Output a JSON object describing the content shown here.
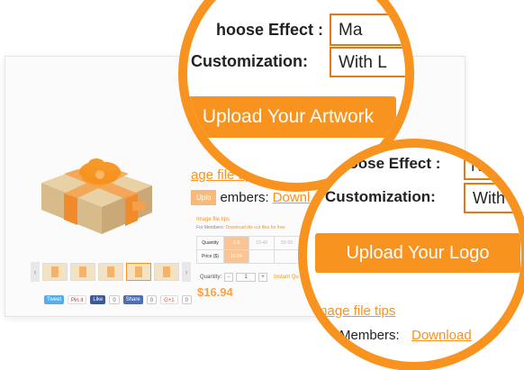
{
  "lens1": {
    "effect_label": "hoose Effect :",
    "effect_value": "Ma",
    "custom_label": "Customization:",
    "custom_value": "With L",
    "upload_button": "Upload Your Artwork",
    "tips_link": "age file tips"
  },
  "lens2": {
    "effect_label": "hoose Effect :",
    "effect_value": "N",
    "custom_label": "Customization:",
    "custom_value": "With",
    "upload_button": "Upload Your Logo",
    "tips_link": "mage file tips",
    "members_label": "Members:",
    "download_link": "Download"
  },
  "background": {
    "upload_small": "Uplo",
    "members_label": "embers:",
    "download_link": "Downl",
    "tiny_tips": "Image file tips",
    "tiny_members": "For Members:",
    "tiny_download": "Download die-cut files for free",
    "quantity_header": "Quantity",
    "price_header": "Price ($)",
    "quantity_values": [
      "1-9",
      "10-49",
      "50-99"
    ],
    "price_values": [
      "16.94",
      "",
      ""
    ],
    "qty_label": "Quantity:",
    "qty_minus": "-",
    "qty_value": "1",
    "qty_plus": "+",
    "qty_link": "Instant Qu",
    "price": "$16.94",
    "social": {
      "tweet": "Tweet",
      "pin": "Pin it",
      "like": "Like",
      "like_count": "0",
      "share": "Share",
      "share_count": "0",
      "gplus": "G+1",
      "gplus_count": "0"
    }
  },
  "colors": {
    "accent": "#f7931e",
    "accent_dark": "#e07a14"
  }
}
